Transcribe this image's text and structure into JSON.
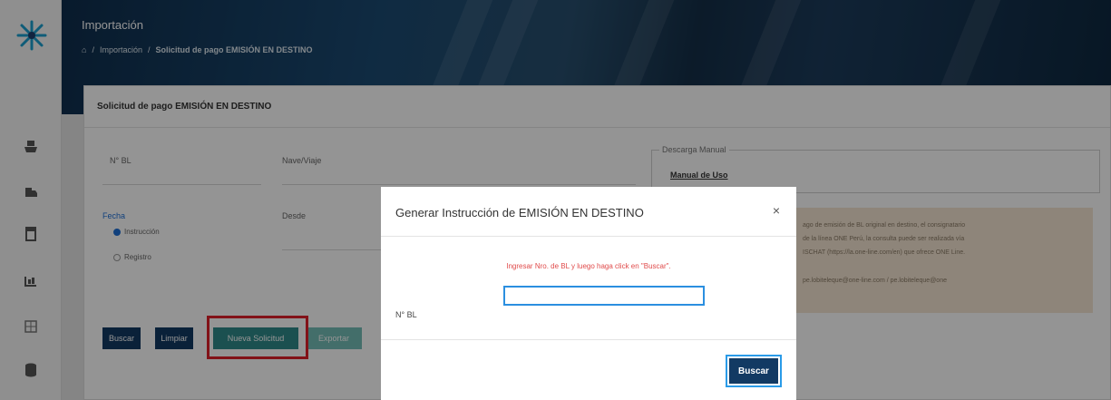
{
  "header": {
    "title": "Importación",
    "breadcrumb": {
      "home_icon": "home-icon",
      "separator": "/",
      "section": "Importación",
      "current": "Solicitud de pago EMISIÓN EN DESTINO"
    }
  },
  "sidebar": {
    "logo": "star-logo",
    "icons": [
      "ship-icon",
      "truck-icon",
      "document-icon",
      "container-icon",
      "grid-icon",
      "database-icon"
    ]
  },
  "form": {
    "heading": "Solicitud de pago EMISIÓN EN DESTINO",
    "bl_label": "N° BL",
    "nave_label": "Nave/Viaje",
    "fecha_label": "Fecha",
    "desde_label": "Desde",
    "radio_options": [
      {
        "label": "Instrucción",
        "selected": true
      },
      {
        "label": "Registro",
        "selected": false
      }
    ],
    "manual": {
      "legend": "Descarga Manual",
      "link": "Manual de Uso"
    },
    "notice": {
      "line1": "ago de emisión de BL original en destino, el consignatario",
      "line2": "de la línea ONE Perú, la consulta puede ser realizada vía",
      "line3": "ISCHAT (https://la.one-line.com/en) que ofrece ONE Line.",
      "line4": "pe.lobiteleque@one-line.com / pe.lobiteleque@one"
    },
    "buttons": {
      "buscar": "Buscar",
      "limpiar": "Limpiar",
      "nueva": "Nueva Solicitud",
      "exportar": "Exportar"
    }
  },
  "modal": {
    "title": "Generar Instrucción de EMISIÓN EN DESTINO",
    "close": "×",
    "hint": "Ingresar Nro. de BL y luego haga click en \"Buscar\".",
    "bl_label": "N° BL",
    "bl_value": "",
    "submit": "Buscar"
  },
  "colors": {
    "primary_button": "#123a63",
    "teal_button": "#2f8a8a",
    "highlight": "#e0202a",
    "hint_text": "#e04a4a",
    "notice_bg": "#f5e6d2"
  }
}
